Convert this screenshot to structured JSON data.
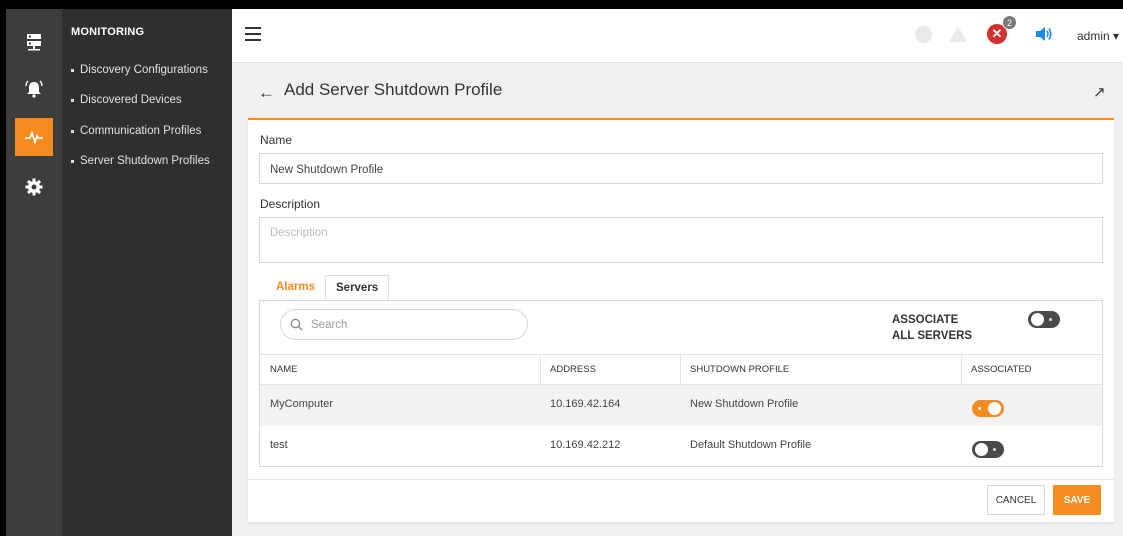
{
  "sidebar": {
    "title": "MONITORING",
    "items": [
      {
        "label": "Discovery Configurations"
      },
      {
        "label": "Discovered Devices"
      },
      {
        "label": "Communication Profiles"
      },
      {
        "label": "Server Shutdown Profiles"
      }
    ],
    "icons": [
      "server-icon",
      "alarm-bell-icon",
      "pulse-icon",
      "gear-icon"
    ],
    "active_icon": "pulse-icon"
  },
  "topbar": {
    "error_badge_count": "2",
    "error_symbol": "✕",
    "user": "admin",
    "user_caret": "▾"
  },
  "page": {
    "back_arrow": "←",
    "title": "Add Server Shutdown Profile",
    "expand_glyph": "↗"
  },
  "form": {
    "name_label": "Name",
    "name_value": "New Shutdown Profile",
    "description_label": "Description",
    "description_placeholder": "Description"
  },
  "tabs": [
    {
      "label": "Alarms",
      "active": false
    },
    {
      "label": "Servers",
      "active": true
    }
  ],
  "servers": {
    "search_placeholder": "Search",
    "associate_all_label": "ASSOCIATE ALL SERVERS",
    "associate_all_on": false,
    "columns": [
      "NAME",
      "ADDRESS",
      "SHUTDOWN PROFILE",
      "ASSOCIATED"
    ],
    "rows": [
      {
        "name": "MyComputer",
        "address": "10.169.42.164",
        "profile": "New Shutdown Profile",
        "associated": true
      },
      {
        "name": "test",
        "address": "10.169.42.212",
        "profile": "Default Shutdown Profile",
        "associated": false
      }
    ]
  },
  "actions": {
    "cancel": "CANCEL",
    "save": "SAVE"
  },
  "colors": {
    "accent": "#f68b1f",
    "sidebar_dark": "#2f2f2f",
    "iconbar": "#3d3d3d",
    "error": "#d32f2f",
    "volume": "#1e88e5"
  }
}
